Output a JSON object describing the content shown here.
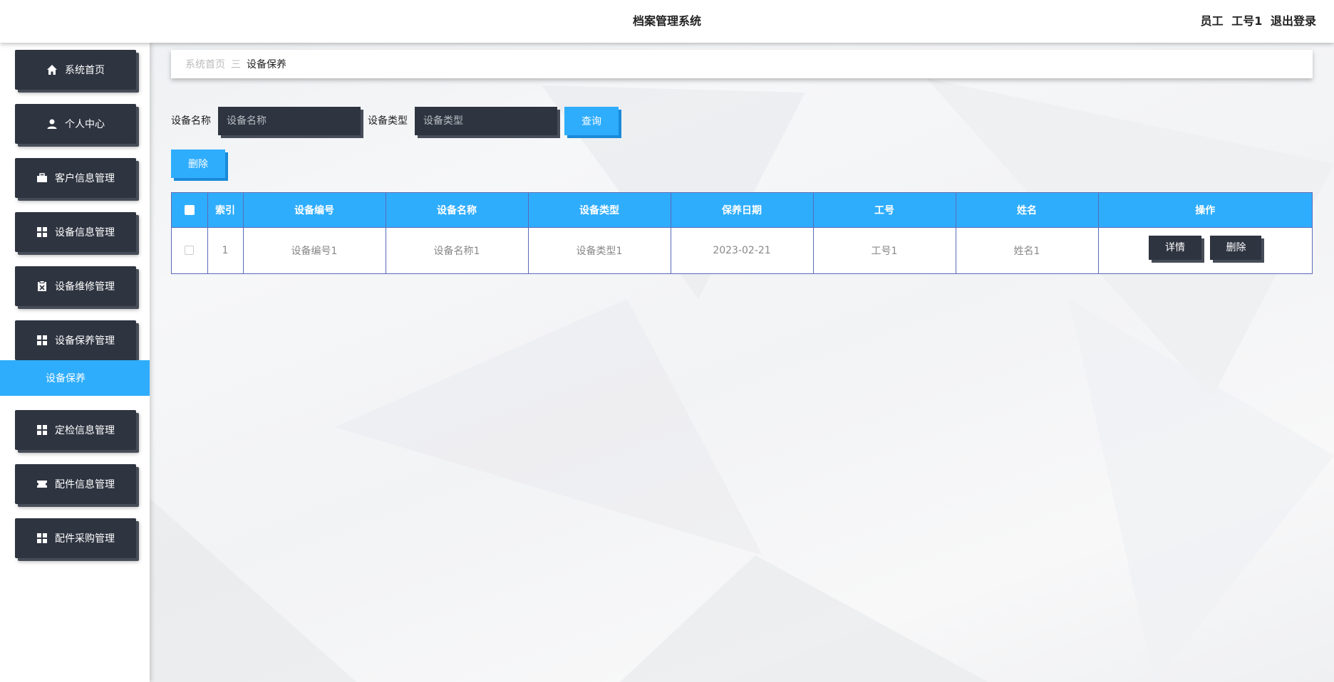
{
  "header": {
    "title": "档案管理系统",
    "user_role": "员工",
    "user_name": "工号1",
    "logout_label": "退出登录"
  },
  "sidebar": {
    "items": [
      {
        "label": "系统首页",
        "icon": "home-icon"
      },
      {
        "label": "个人中心",
        "icon": "user-icon"
      },
      {
        "label": "客户信息管理",
        "icon": "briefcase-icon"
      },
      {
        "label": "设备信息管理",
        "icon": "grid-icon"
      },
      {
        "label": "设备维修管理",
        "icon": "clipboard-icon"
      },
      {
        "label": "设备保养管理",
        "icon": "grid-icon"
      },
      {
        "label": "定检信息管理",
        "icon": "grid-icon"
      },
      {
        "label": "配件信息管理",
        "icon": "ticket-icon"
      },
      {
        "label": "配件采购管理",
        "icon": "grid-icon"
      }
    ],
    "active_submenu": "设备保养"
  },
  "breadcrumb": {
    "home": "系统首页",
    "separator": "三",
    "current": "设备保养"
  },
  "search": {
    "name_label": "设备名称",
    "name_placeholder": "设备名称",
    "type_label": "设备类型",
    "type_placeholder": "设备类型",
    "query_label": "查询"
  },
  "actions": {
    "delete_label": "删除"
  },
  "table": {
    "headers": [
      "索引",
      "设备编号",
      "设备名称",
      "设备类型",
      "保养日期",
      "工号",
      "姓名",
      "操作"
    ],
    "rows": [
      {
        "index": "1",
        "code": "设备编号1",
        "name": "设备名称1",
        "type": "设备类型1",
        "date": "2023-02-21",
        "staff_no": "工号1",
        "staff_name": "姓名1",
        "detail_label": "详情",
        "delete_label": "删除"
      }
    ]
  },
  "colors": {
    "accent": "#2fadfd",
    "dark": "#2e3440",
    "border": "#5a6ab8"
  }
}
